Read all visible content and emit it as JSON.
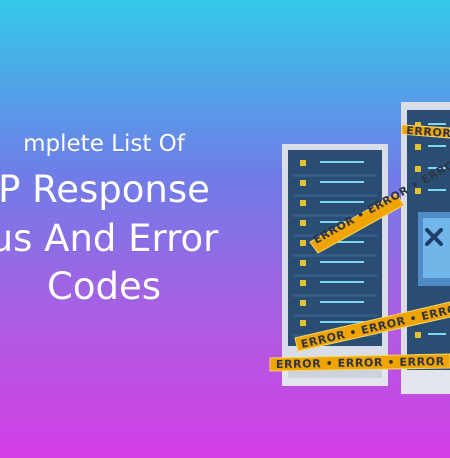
{
  "headline": {
    "line1": "mplete List Of",
    "line2": "P Response",
    "line3": "us And Error",
    "line4": "Codes"
  },
  "illustration": {
    "tape_label": "ERROR • ERROR • ERROR • ERROR • ERROR",
    "icon": "server-rack-icon",
    "screen_icon": "error-x-icon"
  },
  "colors": {
    "background_top": "#34c9e8",
    "background_mid": "#8f6ae5",
    "background_bottom": "#d33ee6",
    "headline_text": "#ffffff",
    "server_dark": "#2a4e73",
    "server_light": "#d8dde7",
    "tape": "#f0a400",
    "screen": "#3c8ec7"
  }
}
